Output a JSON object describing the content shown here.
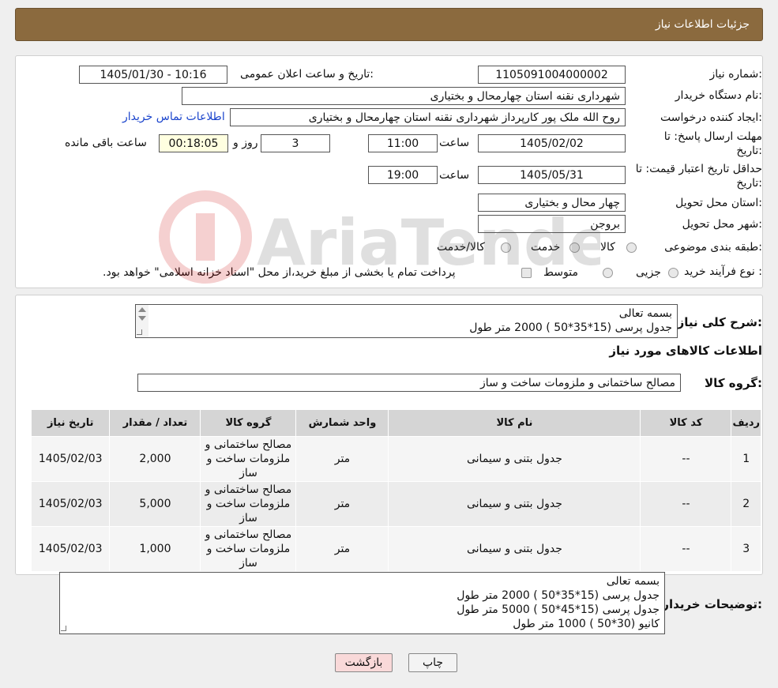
{
  "header": {
    "title": "جزئیات اطلاعات نیاز"
  },
  "form": {
    "need_number_label": "شماره نیاز:",
    "need_number": "1105091004000002",
    "announce_label": "تاریخ و ساعت اعلان عمومی:",
    "announce_value": "1405/01/30 - 10:16",
    "buyer_org_label": "نام دستگاه خریدار:",
    "buyer_org": "شهرداری نقنه استان چهارمحال و بختیاری",
    "requester_label": "ایجاد کننده درخواست:",
    "requester": "روح الله ملک پور کارپرداز شهرداری نقنه استان چهارمحال و بختیاری",
    "contact_link": "اطلاعات تماس خریدار",
    "deadline_label_1": "مهلت ارسال پاسخ: تا",
    "deadline_label_2": "تاریخ:",
    "deadline_date": "1405/02/02",
    "time_label": "ساعت",
    "deadline_time": "11:00",
    "days": "3",
    "days_label": "روز و",
    "remaining_time": "00:18:05",
    "remaining_label": "ساعت باقی مانده",
    "validity_label_1": "حداقل تاریخ اعتبار قیمت: تا",
    "validity_label_2": "تاریخ:",
    "validity_date": "1405/05/31",
    "validity_time": "19:00",
    "province_label": "استان محل تحویل:",
    "province": "چهار محال و بختیاری",
    "city_label": "شهر محل تحویل:",
    "city": "بروجن",
    "category_label": "طبقه بندی موضوعی:",
    "category_options": [
      "کالا",
      "خدمت",
      "کالا/خدمت"
    ],
    "process_label": "نوع فرآیند خرید :",
    "process_options": [
      "جزیی",
      "متوسط"
    ],
    "payment_note": "پرداخت تمام یا بخشی از مبلغ خرید،از محل \"اسناد خزانه اسلامی\" خواهد بود."
  },
  "details": {
    "summary_label": "شرح کلی نیاز:",
    "summary_lines": [
      "بسمه تعالی",
      "جدول پرسی (15*35*50 ) 2000 متر طول"
    ],
    "goods_info_title": "اطلاعات کالاهای مورد نیاز",
    "goods_group_label": "گروه کالا:",
    "goods_group": "مصالح ساختمانی و ملزومات ساخت و ساز"
  },
  "table": {
    "headers": [
      "ردیف",
      "کد کالا",
      "نام کالا",
      "واحد شمارش",
      "گروه کالا",
      "تعداد / مقدار",
      "تاریخ نیاز"
    ],
    "rows": [
      [
        "1",
        "--",
        "جدول بتنی و سیمانی",
        "متر",
        "مصالح ساختمانی و ملزومات ساخت و ساز",
        "2,000",
        "1405/02/03"
      ],
      [
        "2",
        "--",
        "جدول بتنی و سیمانی",
        "متر",
        "مصالح ساختمانی و ملزومات ساخت و ساز",
        "5,000",
        "1405/02/03"
      ],
      [
        "3",
        "--",
        "جدول بتنی و سیمانی",
        "متر",
        "مصالح ساختمانی و ملزومات ساخت و ساز",
        "1,000",
        "1405/02/03"
      ]
    ]
  },
  "buyer_notes": {
    "label": "توضیحات خریدار:",
    "lines": [
      "بسمه تعالی",
      "جدول پرسی (15*35*50 ) 2000 متر طول",
      "جدول پرسی (15*45*50 ) 5000 متر طول",
      "کانیو (30*50 ) 1000 متر طول"
    ]
  },
  "buttons": {
    "print": "چاپ",
    "back": "بازگشت"
  },
  "watermark_text": "AriaTender.neT",
  "colors": {
    "header_bg": "#8b6a3e",
    "link": "#1a44cc",
    "back_button_bg": "#f9d9d9",
    "print_button_bg": "#f3f3f3"
  },
  "icons": [
    "scroll-up-icon",
    "scroll-down-icon",
    "resize-grip-icon",
    "watermark-logo-icon"
  ]
}
